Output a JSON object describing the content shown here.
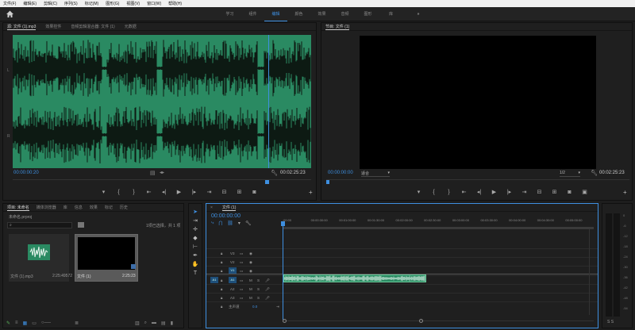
{
  "menu": [
    "文件(F)",
    "编辑(E)",
    "剪辑(C)",
    "序列(S)",
    "标记(M)",
    "图形(G)",
    "视图(V)",
    "窗口(W)",
    "帮助(H)"
  ],
  "workspaces": [
    "学习",
    "组件",
    "编辑",
    "颜色",
    "效果",
    "音频",
    "图形",
    "库"
  ],
  "workspace_more": "»",
  "source": {
    "tabs": [
      "源: 文件 (1).mp3",
      "效果控件",
      "音频剪辑混合器: 文件 (1)",
      "元数据"
    ],
    "current_time": "00:00:00:20",
    "duration": "00:02:25:23",
    "colors": {
      "waveform_bg": "#2a8a62",
      "waveform": "#0d1a13",
      "playhead": "#3e8fe0"
    }
  },
  "program": {
    "tab": "节目: 文件 (1)",
    "current_time": "00:00:00:00",
    "fit": "适合",
    "resolution": "1/2",
    "duration": "00:02:25:23"
  },
  "project": {
    "tabs": [
      "项目: 未命名",
      "媒体浏览器",
      "库",
      "信息",
      "效果",
      "标记",
      "历史"
    ],
    "file": "未命名.prproj",
    "selection": "1项已选择，共 1 项",
    "items": [
      {
        "name": "文件 (1).mp3",
        "duration": "2:25:49572"
      },
      {
        "name": "文件 (1)",
        "duration": "2:25:23"
      }
    ]
  },
  "timeline": {
    "tab": "文件 (1)",
    "current_time": "00:00:00:00",
    "ruler": [
      ":00:00",
      "00:00:30:00",
      "00:01:00:00",
      "00:01:30:00",
      "00:02:00:00",
      "00:02:30:00",
      "00:03:00:00",
      "00:03:30:00",
      "00:04:00:00",
      "00:04:30:00",
      "00:05:00:00"
    ],
    "video_tracks": [
      "V3",
      "V2",
      "V1"
    ],
    "audio_tracks": [
      "A1",
      "A2",
      "A3"
    ],
    "source_patch_v": "V1",
    "source_patch_a": "A1",
    "mute": "M",
    "solo": "S",
    "master": "主声道",
    "master_value": "0.0"
  },
  "audio_meter": {
    "labels": [
      "0",
      "-6",
      "-12",
      "-18",
      "-24",
      "-30",
      "-36",
      "-42",
      "-48",
      "-54"
    ],
    "footer": "S S"
  }
}
